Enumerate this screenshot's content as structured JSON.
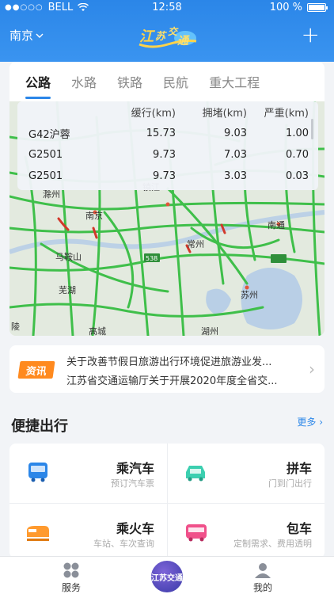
{
  "status_bar": {
    "carrier": "BELL",
    "signal_dots": "●●○○○",
    "time": "12:58",
    "battery": "100 %"
  },
  "header": {
    "city": "南京",
    "logo_text": "江苏交通",
    "add_icon": "plus-icon"
  },
  "transport_tabs": [
    {
      "label": "公路",
      "active": true
    },
    {
      "label": "水路",
      "active": false
    },
    {
      "label": "铁路",
      "active": false
    },
    {
      "label": "民航",
      "active": false
    },
    {
      "label": "重大工程",
      "active": false
    }
  ],
  "traffic_table": {
    "headers": [
      "",
      "缓行(km)",
      "拥堵(km)",
      "严重(km)"
    ],
    "rows": [
      [
        "G42沪蓉",
        "15.73",
        "9.03",
        "1.00"
      ],
      [
        "G2501",
        "9.73",
        "7.03",
        "0.70"
      ],
      [
        "G2501",
        "9.73",
        "3.03",
        "0.03"
      ]
    ]
  },
  "map_labels": {
    "l1": "滁州",
    "l2": "镇江",
    "l3": "南京",
    "l4": "马鞍山",
    "l5": "芜湖",
    "l6": "常州",
    "l7": "南通",
    "l8": "苏州",
    "l9": "湖州",
    "l10": "陵",
    "l11": "高城",
    "l12": "538"
  },
  "news": {
    "badge": "资讯",
    "items": [
      "关于改善节假日旅游出行环境促进旅游业发...",
      "江苏省交通运输厅关于开展2020年度全省交..."
    ]
  },
  "quick_travel": {
    "title": "便捷出行",
    "more": "更多 ›",
    "services": [
      {
        "name": "乘汽车",
        "desc": "预订汽车票",
        "icon": "bus-icon"
      },
      {
        "name": "拼车",
        "desc": "门到门出行",
        "icon": "carpool-icon"
      },
      {
        "name": "乘火车",
        "desc": "车站、车次查询",
        "icon": "train-icon"
      },
      {
        "name": "包车",
        "desc": "定制需求、费用透明",
        "icon": "charter-bus-icon"
      }
    ]
  },
  "bottom_nav": {
    "service": "服务",
    "center": "江苏交通",
    "mine": "我的"
  },
  "colors": {
    "primary": "#2b86e8",
    "badge": "#ff8a1f",
    "road": "#3fbf4a",
    "congestion": "#d2382a"
  }
}
